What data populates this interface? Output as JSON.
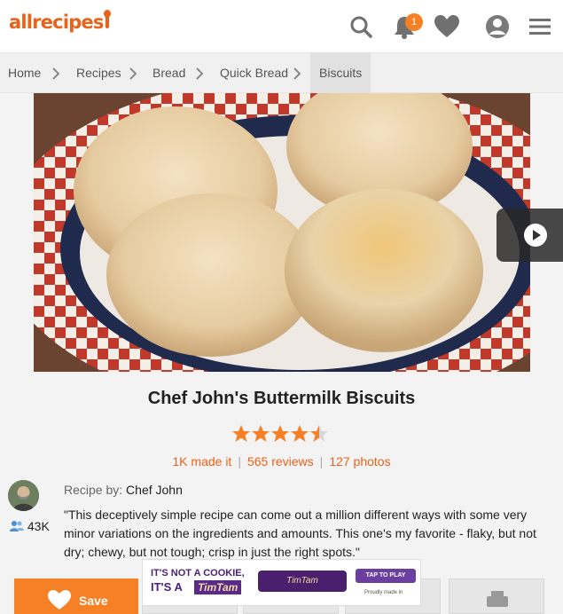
{
  "header": {
    "logo": "allrecipes",
    "notification_count": "1",
    "icons": [
      "search-icon",
      "bell-icon",
      "heart-icon",
      "user-icon",
      "menu-icon"
    ],
    "accent": "#e8621a"
  },
  "breadcrumbs": [
    "Home",
    "Recipes",
    "Bread",
    "Quick Bread",
    "Biscuits"
  ],
  "recipe": {
    "title": "Chef John's Buttermilk Biscuits",
    "rating": 4.5,
    "made_it": "1K made it",
    "reviews": "565 reviews",
    "photos": "127 photos",
    "by_label": "Recipe by:",
    "author": "Chef John",
    "followers": "43K",
    "description": "\"This deceptively simple recipe can come out a million different ways with some very minor variations on the ingredients and amounts. This one's my favorite - flaky, but not dry; chewy, but not tough; crisp in just the right spots.\""
  },
  "actions": {
    "save": "Save"
  },
  "ad": {
    "line1": "IT'S NOT A COOKIE,",
    "line2": "IT'S A",
    "brand": "TimTam",
    "pack": "TimTam",
    "cta": "TAP TO PLAY",
    "made": "Proudly made in"
  }
}
